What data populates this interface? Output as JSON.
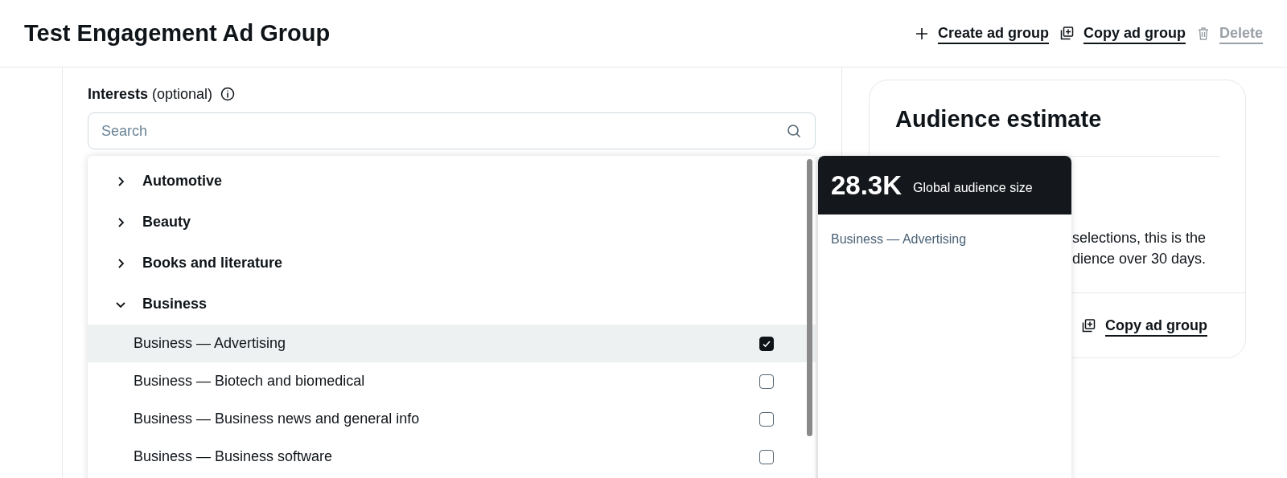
{
  "header": {
    "title": "Test Engagement Ad Group",
    "actions": [
      {
        "kind": "create",
        "label": "Create ad group",
        "disabled": false
      },
      {
        "kind": "copy",
        "label": "Copy ad group",
        "disabled": false
      },
      {
        "kind": "delete",
        "label": "Delete",
        "disabled": true
      }
    ]
  },
  "interests": {
    "label": "**Interests** (optional)",
    "search": {
      "placeholder": "Search"
    },
    "categories": [
      {
        "label": "Automotive",
        "expanded": false
      },
      {
        "label": "Beauty",
        "expanded": false
      },
      {
        "label": "Books and literature",
        "expanded": false
      },
      {
        "label": "Business",
        "expanded": true,
        "children": [
          {
            "label": "Business — Advertising",
            "checked": true,
            "highlighted": true
          },
          {
            "label": "Business — Biotech and biomedical",
            "checked": false,
            "highlighted": false
          },
          {
            "label": "Business — Business news and general info",
            "checked": false,
            "highlighted": false
          },
          {
            "label": "Business — Business software",
            "checked": false,
            "highlighted": false
          }
        ]
      }
    ]
  },
  "audience_popover": {
    "size": "28.3K",
    "caption": "Global audience size",
    "selections": [
      "Business — Advertising"
    ]
  },
  "audience_card": {
    "title": "Audience estimate",
    "description_lines": [
      "selections, this is the",
      "dience over 30 days."
    ],
    "action": {
      "kind": "copy",
      "label": "Copy ad group"
    }
  }
}
